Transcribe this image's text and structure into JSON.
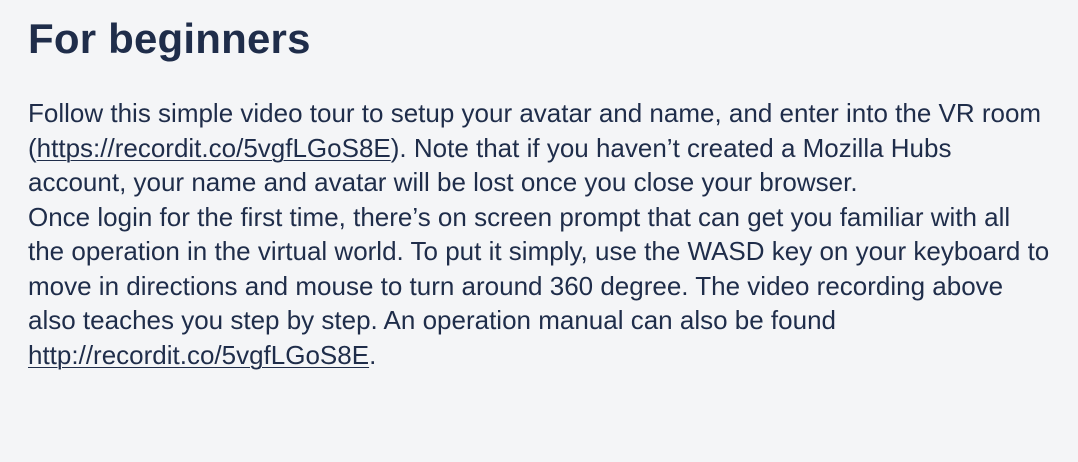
{
  "section": {
    "title": "For beginners",
    "paragraph1": {
      "before_link": "Follow this simple video tour to setup your avatar and name, and enter into the VR room (",
      "link_text": "https://recordit.co/5vgfLGoS8E",
      "after_link": "). Note that if you haven’t created a Mozilla Hubs account, your name and avatar will be lost once you close your browser."
    },
    "paragraph2": {
      "before_link": "Once login for the first time, there’s on screen prompt that can get you familiar with all the operation in the virtual world. To put it simply, use the WASD key on your keyboard to move in directions and mouse to turn around 360 degree. The video recording above also teaches you step by step. An operation manual can also be found ",
      "link_text": "http://recordit.co/5vgfLGoS8E",
      "after_link": "."
    }
  }
}
